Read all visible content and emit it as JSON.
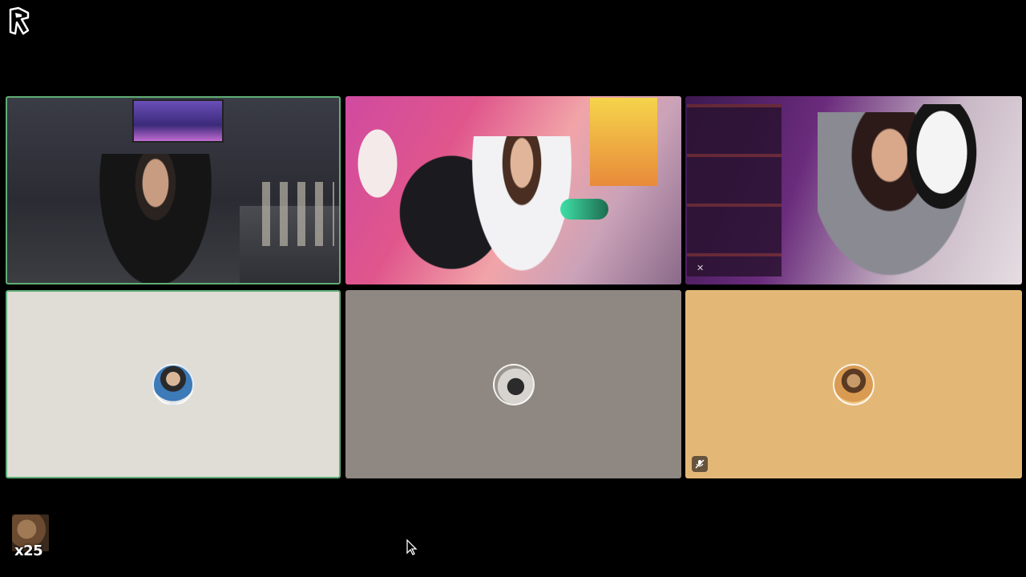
{
  "app": {
    "logo_icon": "app-logo-icon"
  },
  "participants": [
    {
      "id": "p1",
      "state": "video",
      "speaking": true
    },
    {
      "id": "p2",
      "state": "video",
      "speaking": false
    },
    {
      "id": "p3",
      "state": "video",
      "speaking": false,
      "badge_icon": "muted-mic-icon"
    },
    {
      "id": "p4",
      "state": "camera-off",
      "speaking": true,
      "avatar_icon": "avatar"
    },
    {
      "id": "p5",
      "state": "camera-off",
      "speaking": false,
      "avatar_icon": "avatar"
    },
    {
      "id": "p6",
      "state": "camera-off",
      "speaking": false,
      "avatar_icon": "avatar",
      "badge_icon": "muted-mic-icon"
    }
  ],
  "viewers": {
    "count_label": "x25",
    "thumb_icon": "viewer-avatar"
  },
  "colors": {
    "background": "#000000",
    "speaking_border": "#5fae76",
    "tile_1_bg": "#dfddd6",
    "tile_2_bg": "#8f8781",
    "tile_3_bg": "#e3b877"
  }
}
